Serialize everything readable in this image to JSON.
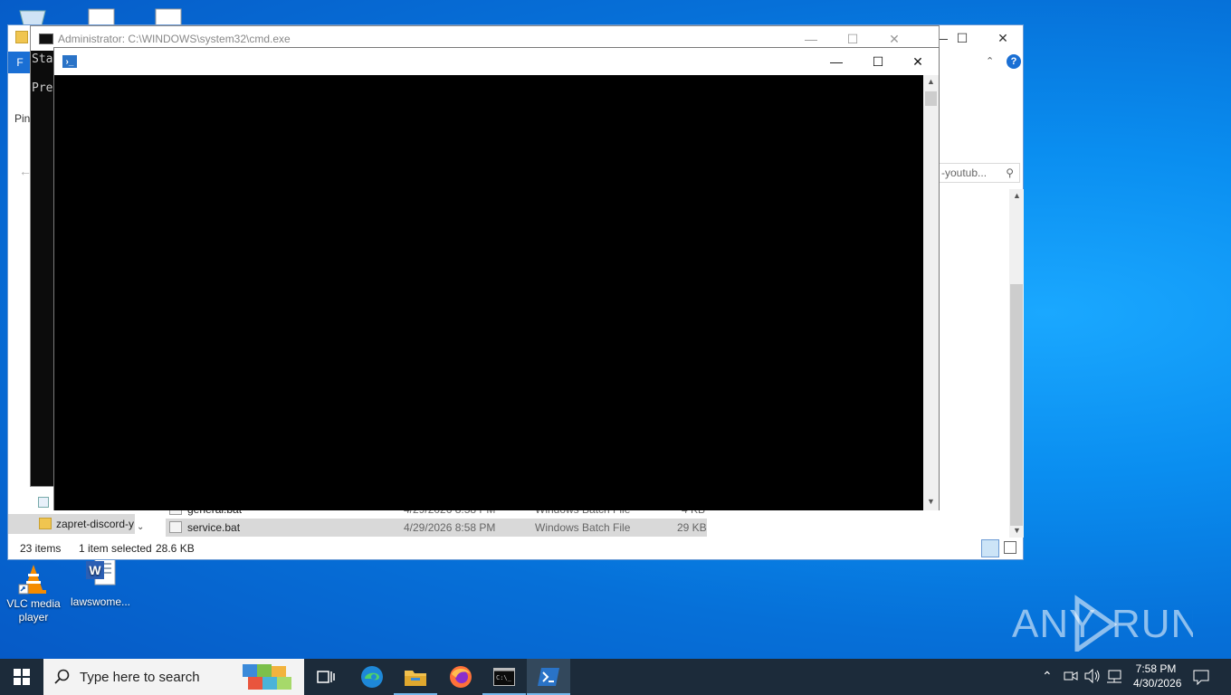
{
  "desktop": {
    "icons": [
      {
        "label": "VLC media player",
        "icon": "vlc-icon"
      },
      {
        "label": "lawswome...",
        "icon": "word-document-icon"
      }
    ],
    "watermark": "ANY RUN"
  },
  "explorer": {
    "search_text": "-youtub...",
    "left_partial_labels": [
      "Pin",
      "F"
    ],
    "nav_item_folder": "zapret-discord-y",
    "files": [
      {
        "name": "general.bat",
        "date": "4/29/2026 8:58 PM",
        "type": "Windows Batch File",
        "size": "4 KB"
      },
      {
        "name": "service.bat",
        "date": "4/29/2026 8:58 PM",
        "type": "Windows Batch File",
        "size": "29 KB"
      }
    ],
    "status": {
      "items": "23 items",
      "selected": "1 item selected",
      "size": "28.6 KB"
    }
  },
  "cmd": {
    "title": "Administrator: C:\\WINDOWS\\system32\\cmd.exe",
    "lines": [
      "Sta",
      "Pre"
    ]
  },
  "powershell": {
    "title": ""
  },
  "taskbar": {
    "search_placeholder": "Type here to search",
    "apps": [
      "task-view-icon",
      "edge-icon",
      "file-explorer-icon",
      "firefox-icon",
      "cmd-icon",
      "powershell-icon"
    ],
    "time": "7:58 PM",
    "date": "4/30/2026"
  },
  "colors": {
    "accent": "#0078d7",
    "taskbar": "#1c2b3a"
  }
}
